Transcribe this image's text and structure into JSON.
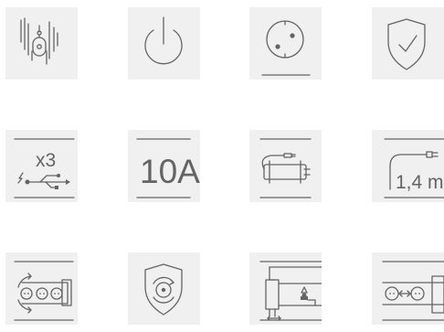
{
  "colors": {
    "tile_background": "#f0f0f0",
    "icon_stroke": "#646464",
    "page_background": "#ffffff"
  },
  "features": [
    {
      "icon": "wall-mount-icon"
    },
    {
      "icon": "power-switch-icon"
    },
    {
      "icon": "grounded-socket-icon"
    },
    {
      "icon": "protection-shield-icon"
    },
    {
      "icon": "usb-charging-icon",
      "text": "x3"
    },
    {
      "icon": "current-rating-icon",
      "text": "10A"
    },
    {
      "icon": "cable-plug-icon"
    },
    {
      "icon": "cable-length-icon",
      "text": "1,4 m"
    },
    {
      "icon": "rotating-sockets-icon"
    },
    {
      "icon": "child-protection-shield-icon"
    },
    {
      "icon": "mounting-clamp-icon"
    },
    {
      "icon": "socket-spacing-icon"
    }
  ]
}
